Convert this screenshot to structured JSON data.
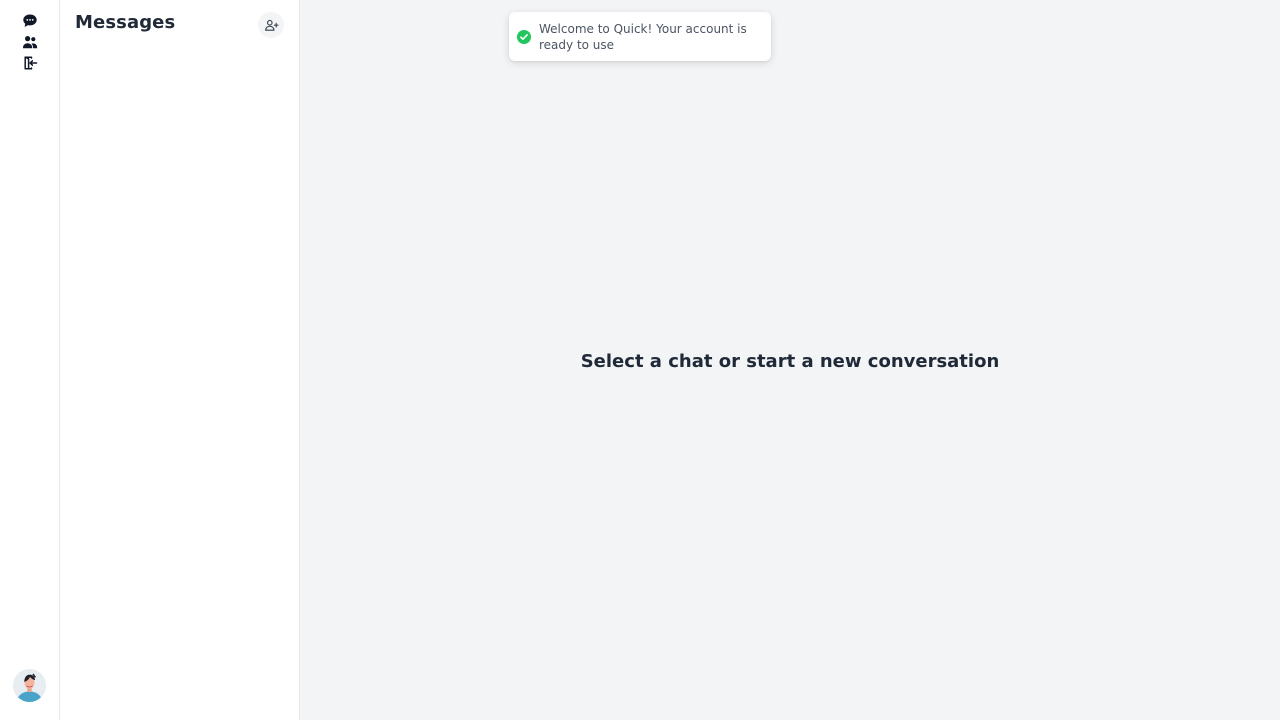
{
  "rail": {
    "icons": [
      "chat-icon",
      "users-icon",
      "logout-icon"
    ]
  },
  "panel": {
    "title": "Messages",
    "new_chat_icon": "add-user-icon"
  },
  "main": {
    "empty_state": "Select a chat or start a new conversation"
  },
  "toast": {
    "message": "Welcome to Quick! Your account is ready to use",
    "status": "success",
    "icon": "check-circle-icon",
    "color": "#22c55e"
  },
  "colors": {
    "background": "#f3f4f6",
    "panel": "#ffffff",
    "text": "#1f2937"
  }
}
